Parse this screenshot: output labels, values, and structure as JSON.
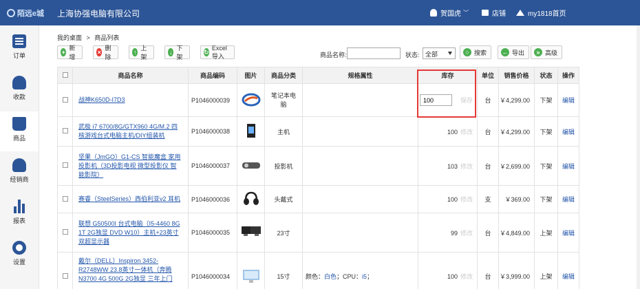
{
  "header": {
    "logo_text": "陌远e城",
    "company": "上海协强电脑有限公司",
    "user": "贺国虎",
    "store": "店铺",
    "home": "my1818首页"
  },
  "sidebar": {
    "items": [
      {
        "label": "订单",
        "icon": "list-icon"
      },
      {
        "label": "收款",
        "icon": "money-bag-icon"
      },
      {
        "label": "商品",
        "icon": "shopping-bag-icon"
      },
      {
        "label": "经销商",
        "icon": "person-icon"
      },
      {
        "label": "报表",
        "icon": "bar-chart-icon"
      },
      {
        "label": "设置",
        "icon": "gear-icon"
      }
    ],
    "active": "商品"
  },
  "breadcrumb": {
    "home": "我的桌面",
    "sep": ">",
    "current": "商品列表"
  },
  "toolbar": {
    "add": "新增",
    "delete": "删除",
    "shelve": "上架",
    "unshelve": "下架",
    "excel_import": "Excel导入",
    "name_label": "商品名称:",
    "status_label": "状态:",
    "status_value": "全部",
    "search": "搜索",
    "export": "导出",
    "advanced": "高级"
  },
  "table": {
    "columns": [
      "商品名称",
      "商品编码",
      "图片",
      "商品分类",
      "规格属性",
      "库存",
      "单位",
      "销售价格",
      "状态",
      "操作"
    ],
    "rows": [
      {
        "name": "战神K650D-I7D3",
        "code": "P1046000039",
        "category": "笔记本电脑",
        "spec": "",
        "stock": "100",
        "stock_save": "保存",
        "unit": "台",
        "price": "￥4,299.00",
        "status": "下架",
        "op": "编辑"
      },
      {
        "name": "武极 i7 6700/8G/GTX960 4G/M.2 四核游戏台式电脑主机/DIY组装机",
        "code": "P1046000038",
        "category": "主机",
        "spec": "",
        "stock": "100",
        "stock_edit": "修改",
        "unit": "台",
        "price": "￥4,299.00",
        "status": "下架",
        "op": "编辑"
      },
      {
        "name": "坚果（JmGO）G1-CS 智能魔盒 家用投影机（3D投影电视 微型投影仪 智能影院）",
        "code": "P1046000037",
        "category": "投影机",
        "spec": "",
        "stock": "103",
        "stock_edit": "修改",
        "unit": "台",
        "price": "￥2,699.00",
        "status": "下架",
        "op": "编辑"
      },
      {
        "name": "赛睿（SteelSeries）西伯利亚v2 耳机",
        "code": "P1046000036",
        "category": "头戴式",
        "spec": "",
        "stock": "100",
        "stock_edit": "修改",
        "unit": "支",
        "price": "￥369.00",
        "status": "下架",
        "op": "编辑"
      },
      {
        "name": "联想 G50500I 台式电脑（I5-4460 8G 1T 2G独显 DVD W10）主机+23英寸双超显示器",
        "code": "P1046000035",
        "category": "23寸",
        "spec": "",
        "stock": "99",
        "stock_edit": "修改",
        "unit": "台",
        "price": "￥4,849.00",
        "status": "上架",
        "op": "编辑"
      },
      {
        "name": "戴尔（DELL）Inspiron 3452-R2748WW 23.8英寸一体机（奔腾N3700 4G 500G 2G独显 三年上门",
        "code": "P1046000034",
        "category": "15寸",
        "spec_label": "颜色：",
        "spec_color": "白色",
        "spec_cpu_label": "；CPU：",
        "spec_cpu": "i5",
        "spec_end": "；",
        "stock": "100",
        "stock_edit": "修改",
        "unit": "台",
        "price": "￥3,999.00",
        "status": "上架",
        "op": "编辑"
      }
    ]
  }
}
